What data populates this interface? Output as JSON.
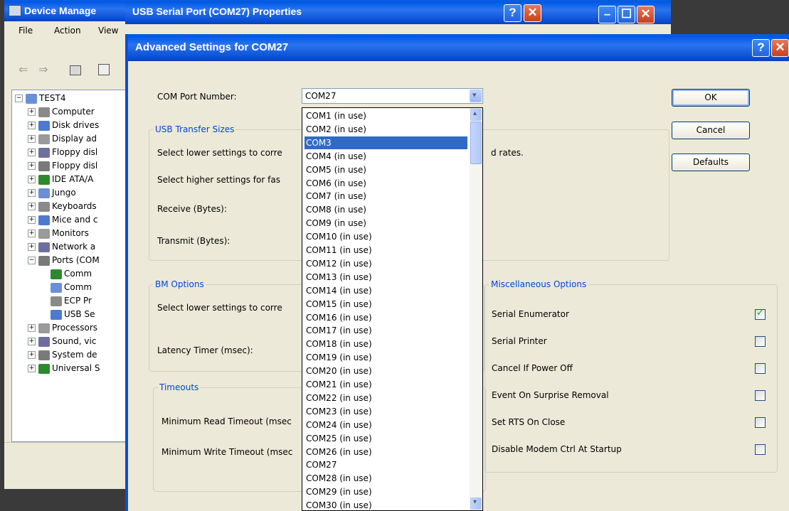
{
  "device_manager": {
    "title": "Device Manage",
    "menu": [
      "File",
      "Action",
      "View"
    ],
    "tree": [
      {
        "label": "TEST4",
        "exp": "−",
        "indent": 0
      },
      {
        "label": "Computer",
        "exp": "+",
        "indent": 1
      },
      {
        "label": "Disk drives",
        "exp": "+",
        "indent": 1
      },
      {
        "label": "Display ad",
        "exp": "+",
        "indent": 1
      },
      {
        "label": "Floppy disl",
        "exp": "+",
        "indent": 1
      },
      {
        "label": "Floppy disl",
        "exp": "+",
        "indent": 1
      },
      {
        "label": "IDE ATA/A",
        "exp": "+",
        "indent": 1
      },
      {
        "label": "Jungo",
        "exp": "+",
        "indent": 1
      },
      {
        "label": "Keyboards",
        "exp": "+",
        "indent": 1
      },
      {
        "label": "Mice and c",
        "exp": "+",
        "indent": 1
      },
      {
        "label": "Monitors",
        "exp": "+",
        "indent": 1
      },
      {
        "label": "Network a",
        "exp": "+",
        "indent": 1
      },
      {
        "label": "Ports (COM",
        "exp": "−",
        "indent": 1
      },
      {
        "label": "Comm",
        "exp": "",
        "indent": 2
      },
      {
        "label": "Comm",
        "exp": "",
        "indent": 2
      },
      {
        "label": "ECP Pr",
        "exp": "",
        "indent": 2
      },
      {
        "label": "USB Se",
        "exp": "",
        "indent": 2
      },
      {
        "label": "Processors",
        "exp": "+",
        "indent": 1
      },
      {
        "label": "Sound, vic",
        "exp": "+",
        "indent": 1
      },
      {
        "label": "System de",
        "exp": "+",
        "indent": 1
      },
      {
        "label": "Universal S",
        "exp": "+",
        "indent": 1
      }
    ]
  },
  "properties_window": {
    "title": "USB Serial Port (COM27) Properties"
  },
  "dialog": {
    "title": "Advanced Settings for COM27",
    "com_port_label": "COM Port Number:",
    "com_port_value": "COM27",
    "usb_transfer": {
      "legend": "USB Transfer Sizes",
      "lower_text": "Select lower settings to corre",
      "rates_tail": "d rates.",
      "higher_text": "Select higher settings for fas",
      "receive_label": "Receive (Bytes):",
      "transmit_label": "Transmit (Bytes):"
    },
    "bm_options": {
      "legend": "BM Options",
      "lower_text": "Select lower settings to corre",
      "latency_label": "Latency Timer (msec):"
    },
    "timeouts": {
      "legend": "Timeouts",
      "read_label": "Minimum Read Timeout (msec",
      "write_label": "Minimum Write Timeout (msec"
    },
    "misc": {
      "legend": "Miscellaneous Options",
      "options": [
        {
          "label": "Serial Enumerator",
          "checked": true
        },
        {
          "label": "Serial Printer",
          "checked": false
        },
        {
          "label": "Cancel If Power Off",
          "checked": false
        },
        {
          "label": "Event On Surprise Removal",
          "checked": false
        },
        {
          "label": "Set RTS On Close",
          "checked": false
        },
        {
          "label": "Disable Modem Ctrl At Startup",
          "checked": false
        }
      ]
    },
    "buttons": {
      "ok": "OK",
      "cancel": "Cancel",
      "defaults": "Defaults"
    }
  },
  "com_dropdown": {
    "selected": "COM3",
    "options": [
      "COM1 (in use)",
      "COM2 (in use)",
      "COM3",
      "COM4 (in use)",
      "COM5 (in use)",
      "COM6 (in use)",
      "COM7 (in use)",
      "COM8 (in use)",
      "COM9 (in use)",
      "COM10 (in use)",
      "COM11 (in use)",
      "COM12 (in use)",
      "COM13 (in use)",
      "COM14 (in use)",
      "COM15 (in use)",
      "COM16 (in use)",
      "COM17 (in use)",
      "COM18 (in use)",
      "COM19 (in use)",
      "COM20 (in use)",
      "COM21 (in use)",
      "COM22 (in use)",
      "COM23 (in use)",
      "COM24 (in use)",
      "COM25 (in use)",
      "COM26 (in use)",
      "COM27",
      "COM28 (in use)",
      "COM29 (in use)",
      "COM30 (in use)"
    ]
  },
  "colors": {
    "accent": "#0046d5",
    "selection": "#316ac5",
    "titlebar": "#0a50d6"
  }
}
